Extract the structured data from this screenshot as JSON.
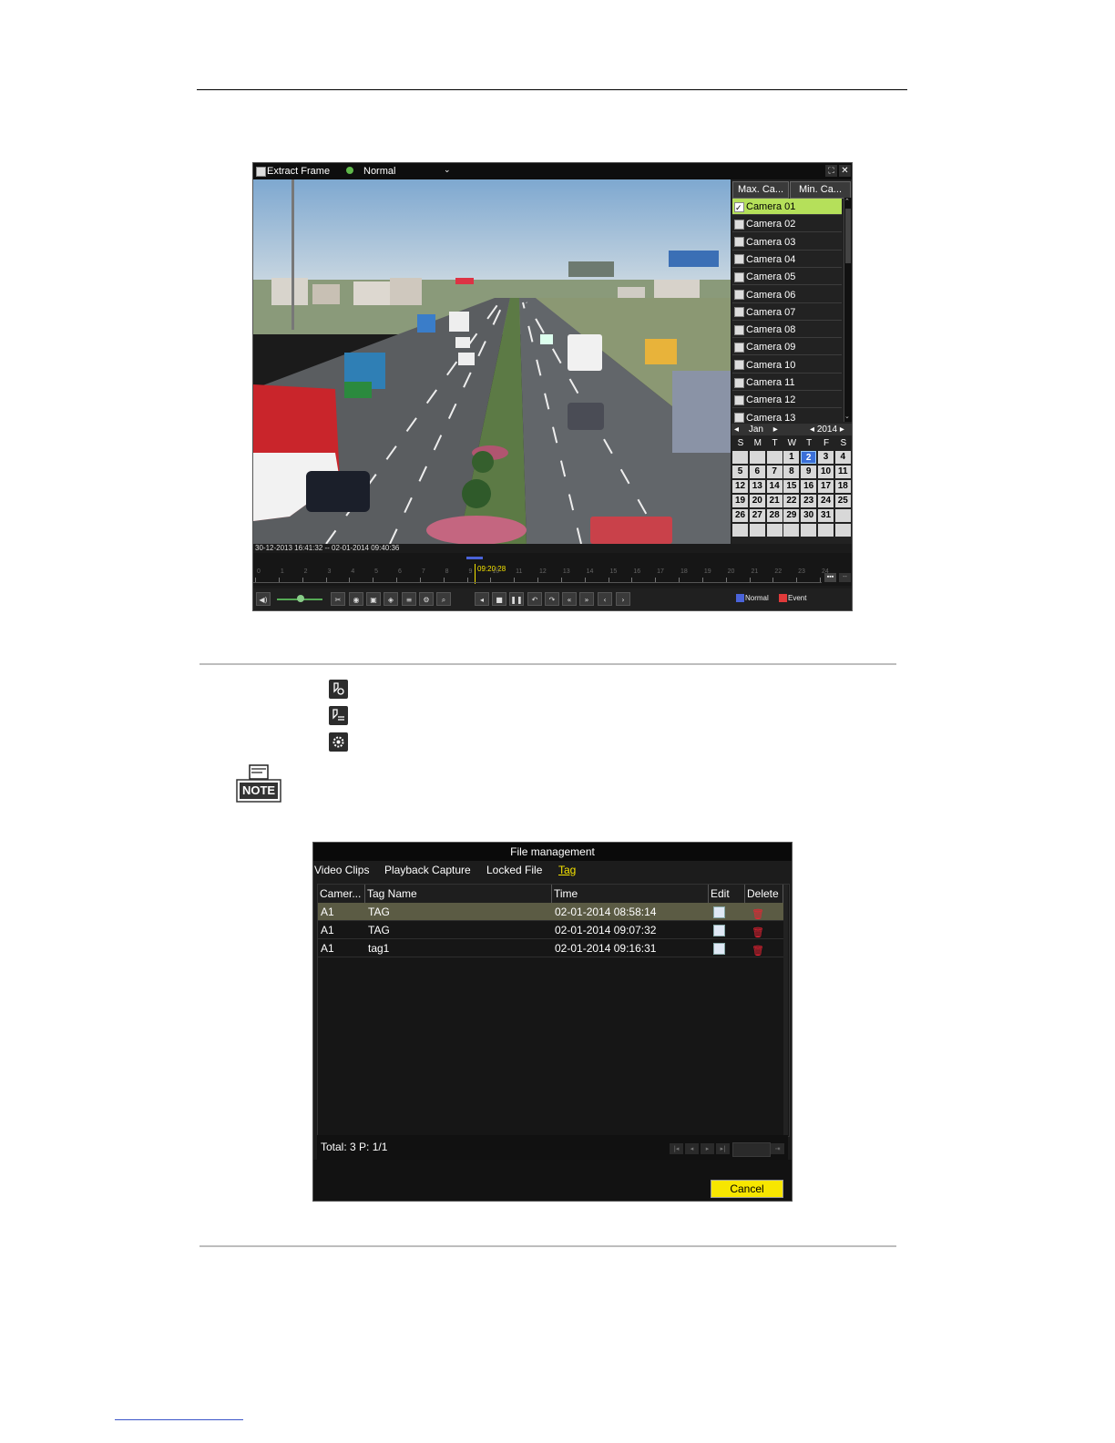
{
  "playback": {
    "extract_frame_label": "Extract Frame",
    "mode_value": "Normal",
    "max_tab": "Max. Ca...",
    "min_tab": "Min. Ca...",
    "cameras": [
      "Camera 01",
      "Camera 02",
      "Camera 03",
      "Camera 04",
      "Camera 05",
      "Camera 06",
      "Camera 07",
      "Camera 08",
      "Camera 09",
      "Camera 10",
      "Camera 11",
      "Camera 12",
      "Camera 13"
    ],
    "selected_camera": "Camera 01",
    "calendar": {
      "month": "Jan",
      "year": "2014",
      "weekdays": [
        "S",
        "M",
        "T",
        "W",
        "T",
        "F",
        "S"
      ],
      "days": [
        "",
        "",
        "",
        "1",
        "2",
        "3",
        "4",
        "5",
        "6",
        "7",
        "8",
        "9",
        "10",
        "11",
        "12",
        "13",
        "14",
        "15",
        "16",
        "17",
        "18",
        "19",
        "20",
        "21",
        "22",
        "23",
        "24",
        "25",
        "26",
        "27",
        "28",
        "29",
        "30",
        "31",
        "",
        "",
        "",
        "",
        "",
        "",
        "",
        ""
      ],
      "selected_day": "2"
    },
    "time_range": "30-12-2013 16:41:32 -- 02-01-2014 09:40:36",
    "cursor_time": "09:20:28",
    "hours": [
      "0",
      "1",
      "2",
      "3",
      "4",
      "5",
      "6",
      "7",
      "8",
      "9",
      "10",
      "11",
      "12",
      "13",
      "14",
      "15",
      "16",
      "17",
      "18",
      "19",
      "20",
      "21",
      "22",
      "23",
      "24"
    ],
    "legend_normal": "Normal",
    "legend_event": "Event",
    "colors": {
      "normal": "#4a63d9",
      "event": "#e03a3a",
      "selected": "#b5e05a"
    }
  },
  "file_management": {
    "title": "File management",
    "tabs": [
      "Video Clips",
      "Playback Capture",
      "Locked File",
      "Tag"
    ],
    "active_tab": "Tag",
    "columns": [
      "Camer...",
      "Tag Name",
      "Time",
      "Edit",
      "Delete"
    ],
    "rows": [
      {
        "camera": "A1",
        "tag": "TAG",
        "time": "02-01-2014 08:58:14"
      },
      {
        "camera": "A1",
        "tag": "TAG",
        "time": "02-01-2014 09:07:32"
      },
      {
        "camera": "A1",
        "tag": "tag1",
        "time": "02-01-2014 09:16:31"
      }
    ],
    "footer": "Total: 3  P: 1/1",
    "cancel_label": "Cancel"
  },
  "note_label": "NOTE"
}
